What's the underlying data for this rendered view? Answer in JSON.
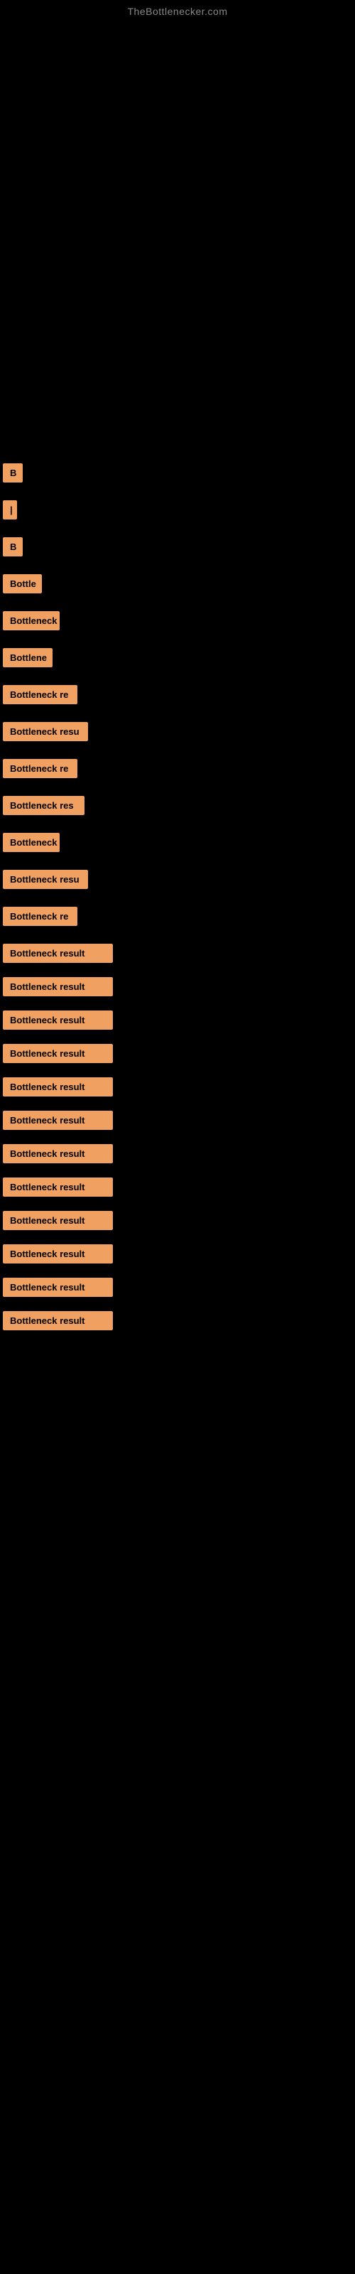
{
  "site": {
    "title": "TheBottlenecker.com"
  },
  "items": [
    {
      "label": "Bottleneck result",
      "size": "xs",
      "width": 28
    },
    {
      "label": "Bottleneck result",
      "size": "xs",
      "width": 14
    },
    {
      "label": "Bottleneck result",
      "size": "xs",
      "width": 28
    },
    {
      "label": "Bottleneck result",
      "size": "sm",
      "width": 55
    },
    {
      "label": "Bottleneck result",
      "size": "sm",
      "width": 75
    },
    {
      "label": "Bottleneck result",
      "size": "md",
      "width": 65
    },
    {
      "label": "Bottleneck result",
      "size": "md",
      "width": 100
    },
    {
      "label": "Bottleneck result",
      "size": "md",
      "width": 112
    },
    {
      "label": "Bottleneck result",
      "size": "md",
      "width": 100
    },
    {
      "label": "Bottleneck result",
      "size": "md",
      "width": 105
    },
    {
      "label": "Bottleneck result",
      "size": "md",
      "width": 75
    },
    {
      "label": "Bottleneck result",
      "size": "lg",
      "width": 118
    },
    {
      "label": "Bottleneck result",
      "size": "lg",
      "width": 100
    },
    {
      "label": "Bottleneck result",
      "size": "xl",
      "width": 145
    },
    {
      "label": "Bottleneck result",
      "size": "xl",
      "width": 145
    },
    {
      "label": "Bottleneck result",
      "size": "xl",
      "width": 145
    },
    {
      "label": "Bottleneck result",
      "size": "xl",
      "width": 145
    },
    {
      "label": "Bottleneck result",
      "size": "xl",
      "width": 145
    },
    {
      "label": "Bottleneck result",
      "size": "xl",
      "width": 145
    },
    {
      "label": "Bottleneck result",
      "size": "xl",
      "width": 145
    },
    {
      "label": "Bottleneck result",
      "size": "xl",
      "width": 145
    },
    {
      "label": "Bottleneck result",
      "size": "xl",
      "width": 145
    },
    {
      "label": "Bottleneck result",
      "size": "xl",
      "width": 145
    },
    {
      "label": "Bottleneck result",
      "size": "xl",
      "width": 145
    },
    {
      "label": "Bottleneck result",
      "size": "xl",
      "width": 145
    }
  ],
  "colors": {
    "background": "#000000",
    "item_bg": "#f0a060",
    "item_text": "#000000",
    "site_title": "#888888"
  }
}
